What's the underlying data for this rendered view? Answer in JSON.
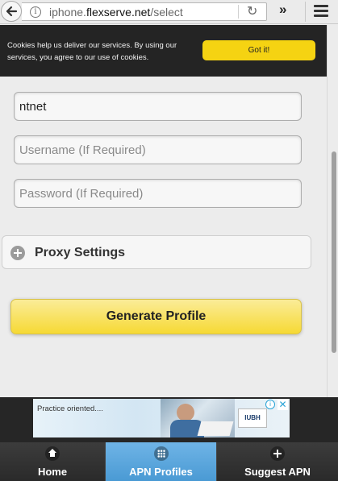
{
  "browser": {
    "url_prefix": "iphone.",
    "url_domain": "flexserve.net",
    "url_path": "/select"
  },
  "cookie_banner": {
    "text": "Cookies help us deliver our services. By using our services, you agree to our use of cookies.",
    "button_label": "Got it!"
  },
  "form": {
    "apn_value": "ntnet",
    "username_placeholder": "Username (If Required)",
    "password_placeholder": "Password (If Required)",
    "proxy_label": "Proxy Settings",
    "generate_label": "Generate Profile"
  },
  "ad": {
    "text": "Practice oriented....",
    "logo_text": "IUBH"
  },
  "nav": {
    "items": [
      {
        "label": "Home",
        "icon": "home-icon"
      },
      {
        "label": "APN Profiles",
        "icon": "grid-icon",
        "active": true
      },
      {
        "label": "Suggest APN",
        "icon": "plus-icon"
      }
    ]
  },
  "colors": {
    "accent_yellow": "#f5d312",
    "active_tab": "#5aa7dd",
    "banner_bg": "#242424"
  }
}
